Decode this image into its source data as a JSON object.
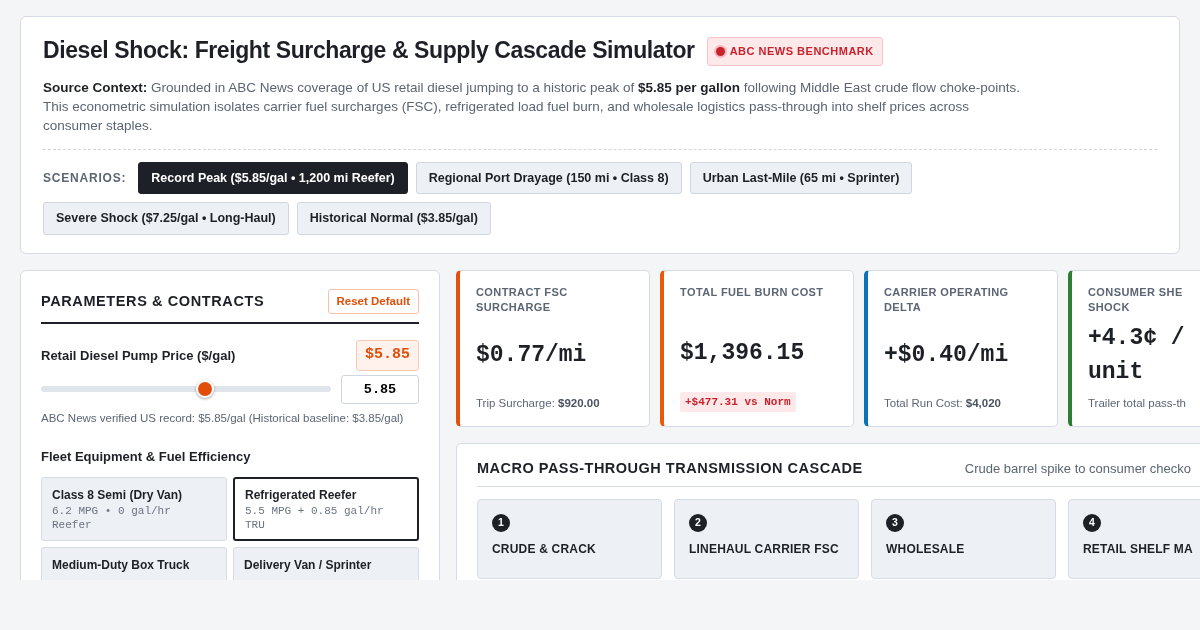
{
  "header": {
    "title": "Diesel Shock: Freight Surcharge & Supply Cascade Simulator",
    "badge": "ABC NEWS BENCHMARK",
    "context": "**Source Context:** Grounded in ABC News coverage of US retail diesel jumping to a historic peak of **$5.85 per gallon** following Middle East crude flow choke-points. This econometric simulation isolates carrier fuel surcharges (FSC), refrigerated load fuel burn, and wholesale logistics pass-through into shelf prices across consumer staples.",
    "scenarios_label": "SCENARIOS:",
    "scenarios": [
      {
        "label": "Record Peak ($5.85/gal • 1,200 mi Reefer)",
        "selected": true
      },
      {
        "label": "Regional Port Drayage (150 mi • Class 8)",
        "selected": false
      },
      {
        "label": "Urban Last-Mile (65 mi • Sprinter)",
        "selected": false
      },
      {
        "label": "Severe Shock ($7.25/gal • Long-Haul)",
        "selected": false
      },
      {
        "label": "Historical Normal ($3.85/gal)",
        "selected": false
      }
    ]
  },
  "parameters": {
    "title": "PARAMETERS & CONTRACTS",
    "reset": "Reset Default",
    "price_label": "Retail Diesel Pump Price ($/gal)",
    "price_badge": "$5.85",
    "slider": {
      "level": 0.565
    },
    "price_value": "5.85",
    "note": "ABC News verified US record: $5.85/gal (Historical baseline: $3.85/gal)",
    "fleet_title": "Fleet Equipment & Fuel Efficiency",
    "fleet": [
      {
        "name": "Class 8 Semi (Dry Van)",
        "spec": "6.2 MPG • 0 gal/hr Reefer",
        "selected": false
      },
      {
        "name": "Refrigerated Reefer",
        "spec": "5.5 MPG + 0.85 gal/hr TRU",
        "selected": true
      },
      {
        "name": "Medium-Duty Box Truck",
        "selected": false
      },
      {
        "name": "Delivery Van / Sprinter",
        "selected": false
      }
    ]
  },
  "metrics": [
    {
      "label": "CONTRACT FSC SURCHARGE",
      "value": "$0.77/mi",
      "kind": "note",
      "note_label": "Trip Surcharge:",
      "note_value": "$920.00",
      "color": "#e2520f"
    },
    {
      "label": "TOTAL FUEL BURN COST",
      "value": "$1,396.15",
      "kind": "delta",
      "delta": "+$477.31 vs Norm",
      "color": "#ea580c"
    },
    {
      "label": "CARRIER OPERATING DELTA",
      "value": "+$0.40/mi",
      "kind": "note",
      "note_label": "Total Run Cost:",
      "note_value": "$4,020",
      "color": "#0b72b8"
    },
    {
      "label": "CONSUMER SHE SHOCK",
      "value": "+4.3¢ / unit",
      "kind": "note",
      "note_label": "Trailer total pass-th",
      "color": "#2e7d32"
    }
  ],
  "cascade": {
    "title": "MACRO PASS-THROUGH TRANSMISSION CASCADE",
    "subtitle": "Crude barrel spike to consumer checko",
    "steps": [
      {
        "number": "1",
        "title": "CRUDE & CRACK"
      },
      {
        "number": "2",
        "title": "LINEHAUL CARRIER FSC"
      },
      {
        "number": "3",
        "title": "WHOLESALE"
      },
      {
        "number": "4",
        "title": "RETAIL SHELF MA"
      }
    ]
  }
}
